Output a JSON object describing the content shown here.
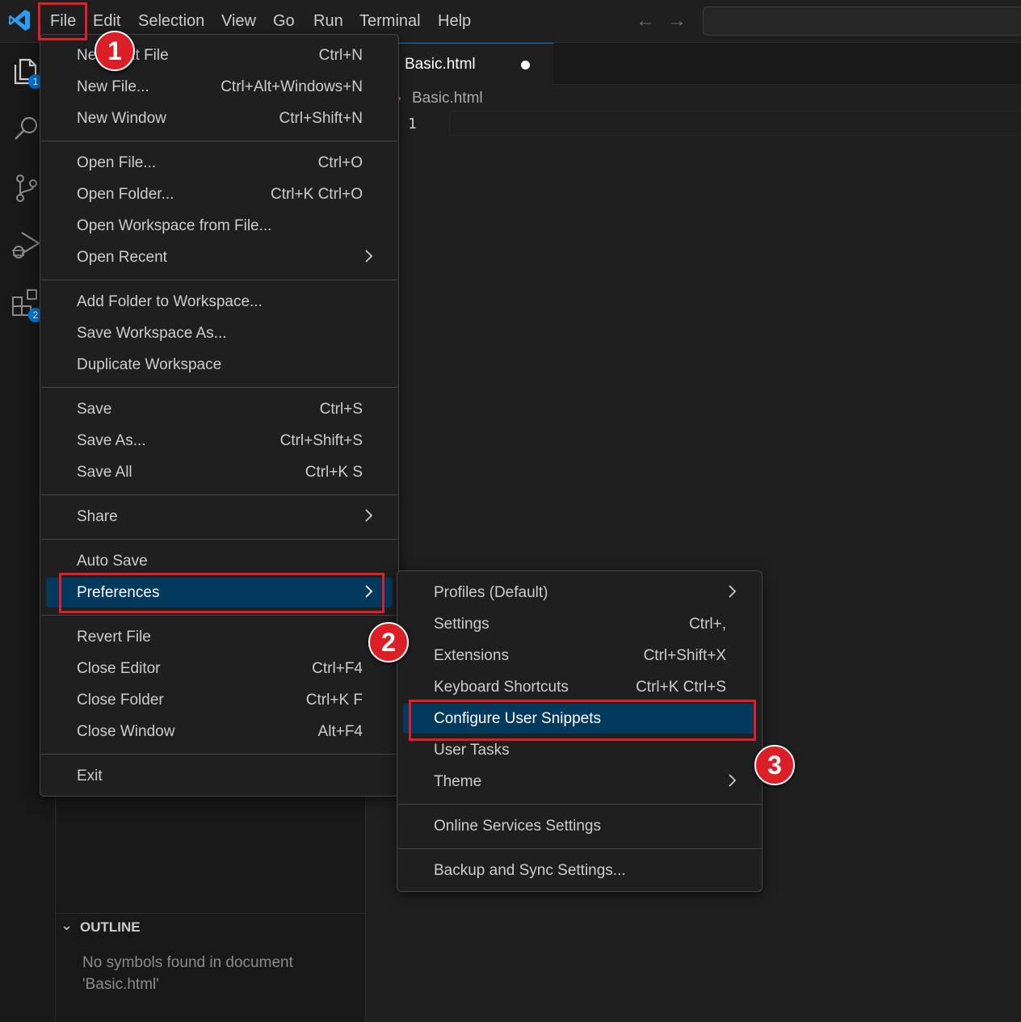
{
  "titlebar": {
    "menus": [
      "File",
      "Edit",
      "Selection",
      "View",
      "Go",
      "Run",
      "Terminal",
      "Help"
    ]
  },
  "activitybar": {
    "explorer_badge": "1",
    "extensions_badge": "2"
  },
  "sidebar": {
    "outline_title": "OUTLINE",
    "outline_message": "No symbols found in document 'Basic.html'"
  },
  "editor": {
    "tab_label": "Basic.html",
    "breadcrumb": "Basic.html",
    "line_number": "1"
  },
  "file_menu": {
    "items": [
      {
        "label": "New Text File",
        "shortcut": "Ctrl+N"
      },
      {
        "label": "New File...",
        "shortcut": "Ctrl+Alt+Windows+N"
      },
      {
        "label": "New Window",
        "shortcut": "Ctrl+Shift+N"
      },
      {
        "label": "Open File...",
        "shortcut": "Ctrl+O"
      },
      {
        "label": "Open Folder...",
        "shortcut": "Ctrl+K Ctrl+O"
      },
      {
        "label": "Open Workspace from File...",
        "shortcut": ""
      },
      {
        "label": "Open Recent",
        "shortcut": ""
      },
      {
        "label": "Add Folder to Workspace...",
        "shortcut": ""
      },
      {
        "label": "Save Workspace As...",
        "shortcut": ""
      },
      {
        "label": "Duplicate Workspace",
        "shortcut": ""
      },
      {
        "label": "Save",
        "shortcut": "Ctrl+S"
      },
      {
        "label": "Save As...",
        "shortcut": "Ctrl+Shift+S"
      },
      {
        "label": "Save All",
        "shortcut": "Ctrl+K S"
      },
      {
        "label": "Share",
        "shortcut": ""
      },
      {
        "label": "Auto Save",
        "shortcut": ""
      },
      {
        "label": "Preferences",
        "shortcut": ""
      },
      {
        "label": "Revert File",
        "shortcut": ""
      },
      {
        "label": "Close Editor",
        "shortcut": "Ctrl+F4"
      },
      {
        "label": "Close Folder",
        "shortcut": "Ctrl+K F"
      },
      {
        "label": "Close Window",
        "shortcut": "Alt+F4"
      },
      {
        "label": "Exit",
        "shortcut": ""
      }
    ]
  },
  "pref_menu": {
    "items": [
      {
        "label": "Profiles (Default)",
        "shortcut": ""
      },
      {
        "label": "Settings",
        "shortcut": "Ctrl+,"
      },
      {
        "label": "Extensions",
        "shortcut": "Ctrl+Shift+X"
      },
      {
        "label": "Keyboard Shortcuts",
        "shortcut": "Ctrl+K Ctrl+S"
      },
      {
        "label": "Configure User Snippets",
        "shortcut": ""
      },
      {
        "label": "User Tasks",
        "shortcut": ""
      },
      {
        "label": "Theme",
        "shortcut": ""
      },
      {
        "label": "Online Services Settings",
        "shortcut": ""
      },
      {
        "label": "Backup and Sync Settings...",
        "shortcut": ""
      }
    ]
  },
  "annotations": {
    "step1": "1",
    "step2": "2",
    "step3": "3"
  },
  "colors": {
    "accent": "#0078d4",
    "menu_highlight": "#04395e",
    "annotation_red": "#e11d2a"
  }
}
